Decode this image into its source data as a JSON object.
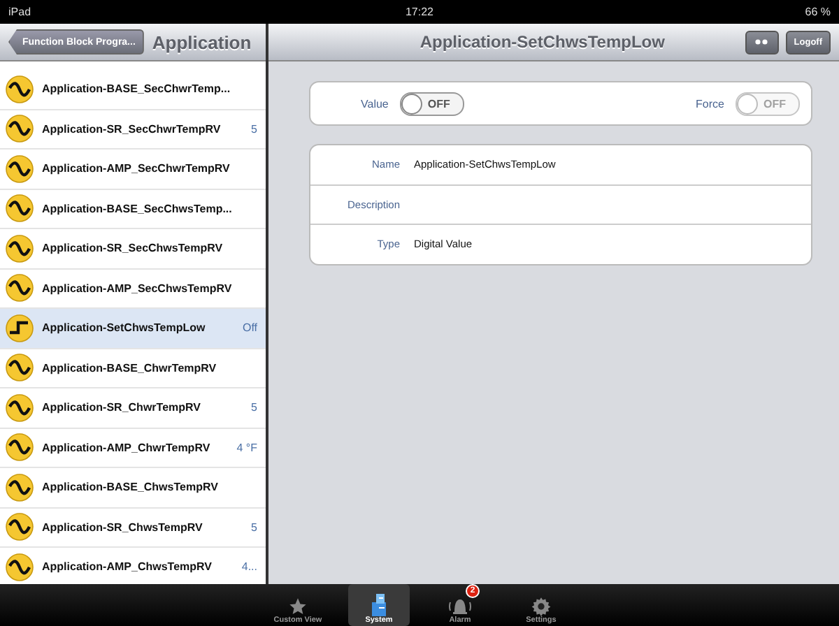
{
  "status_bar": {
    "device": "iPad",
    "time": "17:22",
    "battery": "66 %"
  },
  "left_nav": {
    "back_button": "Function Block Progra...",
    "title": "Application"
  },
  "list": [
    {
      "kind": "analog",
      "name": "Application-BASE_SecChwrTemp...",
      "selected": false
    },
    {
      "kind": "analog",
      "name": "Application-SR_SecChwrTempRV",
      "value": "5",
      "selected": false
    },
    {
      "kind": "analog",
      "name": "Application-AMP_SecChwrTempRV",
      "selected": false
    },
    {
      "kind": "analog",
      "name": "Application-BASE_SecChwsTemp...",
      "selected": false
    },
    {
      "kind": "analog",
      "name": "Application-SR_SecChwsTempRV",
      "selected": false
    },
    {
      "kind": "analog",
      "name": "Application-AMP_SecChwsTempRV",
      "selected": false
    },
    {
      "kind": "digital",
      "name": "Application-SetChwsTempLow",
      "value": "Off",
      "selected": true
    },
    {
      "kind": "analog",
      "name": "Application-BASE_ChwrTempRV",
      "selected": false
    },
    {
      "kind": "analog",
      "name": "Application-SR_ChwrTempRV",
      "value": "5",
      "selected": false
    },
    {
      "kind": "analog",
      "name": "Application-AMP_ChwrTempRV",
      "value": "4 °F",
      "selected": false
    },
    {
      "kind": "analog",
      "name": "Application-BASE_ChwsTempRV",
      "selected": false
    },
    {
      "kind": "analog",
      "name": "Application-SR_ChwsTempRV",
      "value": "5",
      "selected": false
    },
    {
      "kind": "analog",
      "name": "Application-AMP_ChwsTempRV",
      "value": "4...",
      "selected": false
    }
  ],
  "detail_nav": {
    "title": "Application-SetChwsTempLow",
    "buttons": [
      "Logoff"
    ]
  },
  "controls": [
    {
      "label": "Value",
      "toggle": "OFF",
      "on": false,
      "disabled": false
    },
    {
      "label": "Force",
      "toggle": "OFF",
      "on": false,
      "disabled": true
    }
  ],
  "properties": [
    {
      "label": "Name",
      "value": "Application-SetChwsTempLow"
    },
    {
      "label": "Description"
    },
    {
      "label": "Type",
      "value": "Digital Value"
    }
  ],
  "tab_bar": [
    {
      "kind": "star",
      "label": "Custom View",
      "selected": false
    },
    {
      "kind": "system",
      "label": "System",
      "selected": true
    },
    {
      "kind": "bell",
      "label": "Alarm",
      "badge": "2",
      "selected": false
    },
    {
      "kind": "gear",
      "label": "Settings",
      "selected": false
    }
  ]
}
